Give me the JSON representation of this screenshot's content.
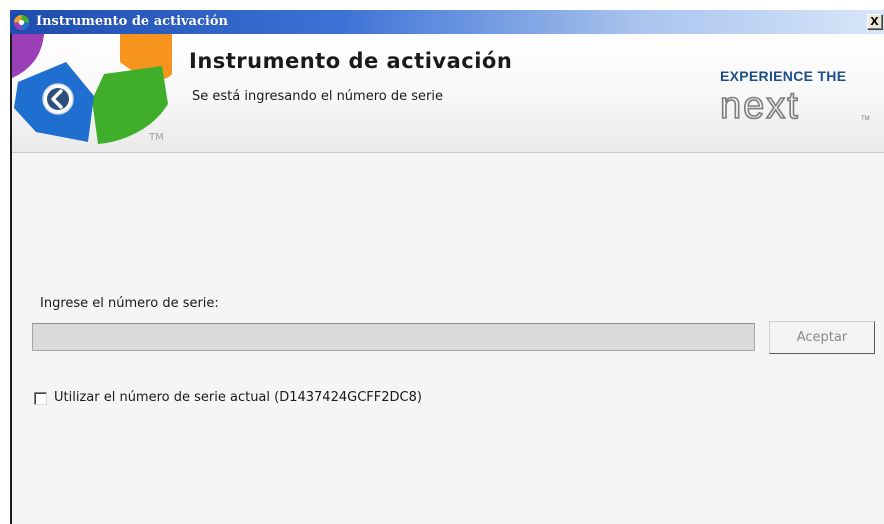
{
  "window": {
    "title": "Instrumento de activación",
    "close_glyph": "X"
  },
  "header": {
    "title": "Instrumento de activación",
    "subtitle": "Se está ingresando el número de serie",
    "logo_trademark": "TM",
    "back_icon": "chevron-left-icon",
    "brand_line": "EXPERIENCE THE",
    "brand_word": "next",
    "brand_trademark": "TM"
  },
  "form": {
    "serial_label": "Ingrese el número de serie:",
    "serial_value": "",
    "accept_label": "Aceptar",
    "use_current_label": "Utilizar el número de serie actual (D1437424GCFF2DC8)",
    "use_current_checked": false
  },
  "colors": {
    "titlebar_start": "#1d4cae",
    "titlebar_end": "#d8e6f9",
    "brand_blue": "#1c4f8a",
    "logo_blue": "#1f6fd1",
    "logo_green": "#3fae2a",
    "logo_orange": "#f7941d",
    "logo_purple": "#9a3fb6"
  }
}
